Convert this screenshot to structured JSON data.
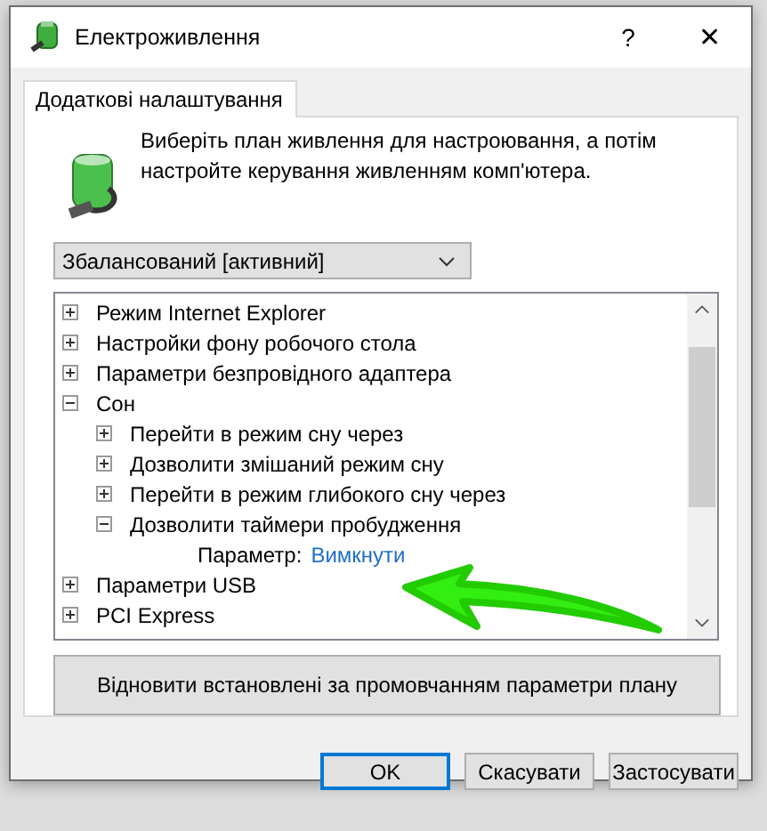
{
  "window": {
    "title": "Електроживлення",
    "help": "?",
    "close": "✕"
  },
  "tabs": [
    {
      "label": "Додаткові налаштування",
      "selected": true
    }
  ],
  "intro": "Виберіть план живлення для настроювання, а потім настройте керування живленням комп'ютера.",
  "plan_dropdown": {
    "value": "Збалансований [активний]"
  },
  "tree": [
    {
      "kind": "group",
      "label": "Режим Internet Explorer",
      "expanded": false
    },
    {
      "kind": "group",
      "label": "Настройки фону робочого стола",
      "expanded": false
    },
    {
      "kind": "group",
      "label": "Параметри безпровідного адаптера",
      "expanded": false
    },
    {
      "kind": "group",
      "label": "Сон",
      "expanded": true,
      "children": [
        {
          "kind": "group",
          "label": "Перейти в режим сну через",
          "expanded": false
        },
        {
          "kind": "group",
          "label": "Дозволити змішаний режим сну",
          "expanded": false
        },
        {
          "kind": "group",
          "label": "Перейти в режим глибокого сну через",
          "expanded": false
        },
        {
          "kind": "group",
          "label": "Дозволити таймери пробудження",
          "expanded": true,
          "children": [
            {
              "kind": "setting",
              "label": "Параметр:",
              "value": "Вимкнути"
            }
          ]
        }
      ]
    },
    {
      "kind": "group",
      "label": "Параметри USB",
      "expanded": false
    },
    {
      "kind": "group",
      "label": "PCI Express",
      "expanded": false
    }
  ],
  "restore_button": "Відновити встановлені за промовчанням параметри плану",
  "buttons": [
    {
      "label": "OK",
      "default": true
    },
    {
      "label": "Скасувати",
      "default": false
    },
    {
      "label": "Застосувати",
      "default": false
    }
  ]
}
